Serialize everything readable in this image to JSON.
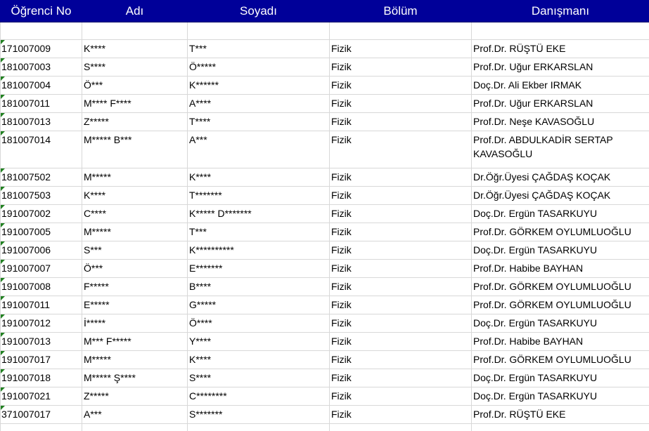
{
  "headers": {
    "id": "Öğrenci No",
    "name": "Adı",
    "surname": "Soyadı",
    "dept": "Bölüm",
    "advisor": "Danışmanı"
  },
  "rows": [
    {
      "id": "171007009",
      "name": "K****",
      "surname": "T***",
      "dept": "Fizik",
      "advisor": "Prof.Dr. RÜŞTÜ EKE"
    },
    {
      "id": "181007003",
      "name": "S****",
      "surname": "Ö*****",
      "dept": "Fizik",
      "advisor": "Prof.Dr. Uğur ERKARSLAN"
    },
    {
      "id": "181007004",
      "name": "Ö***",
      "surname": "K******",
      "dept": "Fizik",
      "advisor": "Doç.Dr. Ali Ekber IRMAK"
    },
    {
      "id": "181007011",
      "name": "M**** F****",
      "surname": "A****",
      "dept": "Fizik",
      "advisor": "Prof.Dr. Uğur ERKARSLAN"
    },
    {
      "id": "181007013",
      "name": "Z*****",
      "surname": "T****",
      "dept": "Fizik",
      "advisor": "Prof.Dr. Neşe KAVASOĞLU"
    },
    {
      "id": "181007014",
      "name": "M***** B***",
      "surname": "A***",
      "dept": "Fizik",
      "advisor": "Prof.Dr. ABDULKADİR SERTAP KAVASOĞLU"
    },
    {
      "id": "181007502",
      "name": "M*****",
      "surname": "K****",
      "dept": "Fizik",
      "advisor": "Dr.Öğr.Üyesi ÇAĞDAŞ KOÇAK"
    },
    {
      "id": "181007503",
      "name": "K****",
      "surname": "T*******",
      "dept": "Fizik",
      "advisor": "Dr.Öğr.Üyesi ÇAĞDAŞ KOÇAK"
    },
    {
      "id": "191007002",
      "name": "C****",
      "surname": "K***** D*******",
      "dept": "Fizik",
      "advisor": "Doç.Dr. Ergün TASARKUYU"
    },
    {
      "id": "191007005",
      "name": "M*****",
      "surname": "T***",
      "dept": "Fizik",
      "advisor": "Prof.Dr. GÖRKEM OYLUMLUOĞLU"
    },
    {
      "id": "191007006",
      "name": "S***",
      "surname": "K**********",
      "dept": "Fizik",
      "advisor": "Doç.Dr. Ergün TASARKUYU"
    },
    {
      "id": "191007007",
      "name": "Ö***",
      "surname": "E*******",
      "dept": "Fizik",
      "advisor": "Prof.Dr. Habibe BAYHAN"
    },
    {
      "id": "191007008",
      "name": "F*****",
      "surname": "B****",
      "dept": "Fizik",
      "advisor": "Prof.Dr. GÖRKEM OYLUMLUOĞLU"
    },
    {
      "id": "191007011",
      "name": "E*****",
      "surname": "G*****",
      "dept": "Fizik",
      "advisor": "Prof.Dr. GÖRKEM OYLUMLUOĞLU"
    },
    {
      "id": "191007012",
      "name": "İ*****",
      "surname": "Ö****",
      "dept": "Fizik",
      "advisor": "Doç.Dr. Ergün TASARKUYU"
    },
    {
      "id": "191007013",
      "name": "M*** F*****",
      "surname": "Y****",
      "dept": "Fizik",
      "advisor": "Prof.Dr. Habibe BAYHAN"
    },
    {
      "id": "191007017",
      "name": "M*****",
      "surname": "K****",
      "dept": "Fizik",
      "advisor": "Prof.Dr. GÖRKEM OYLUMLUOĞLU"
    },
    {
      "id": "191007018",
      "name": "M***** Ş****",
      "surname": "S****",
      "dept": "Fizik",
      "advisor": "Doç.Dr. Ergün TASARKUYU"
    },
    {
      "id": "191007021",
      "name": "Z*****",
      "surname": "C********",
      "dept": "Fizik",
      "advisor": "Doç.Dr. Ergün TASARKUYU"
    },
    {
      "id": "371007017",
      "name": "A***",
      "surname": "S*******",
      "dept": "Fizik",
      "advisor": "Prof.Dr. RÜŞTÜ EKE"
    }
  ]
}
